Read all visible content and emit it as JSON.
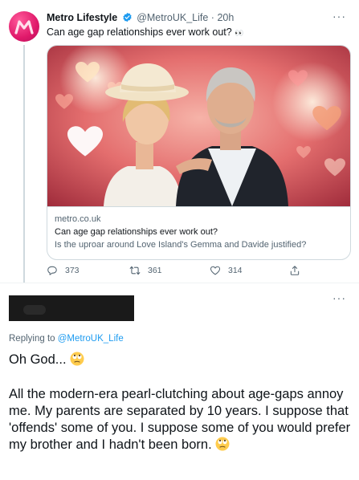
{
  "tweet": {
    "author_name": "Metro Lifestyle",
    "author_handle": "@MetroUK_Life",
    "separator": "·",
    "time": "20h",
    "text": "Can age gap relationships ever work out?",
    "eyes_emoji": "👀",
    "more": "···",
    "card": {
      "domain": "metro.co.uk",
      "title": "Can age gap relationships ever work out?",
      "description": "Is the uproar around Love Island's Gemma and Davide justified?"
    },
    "actions": {
      "reply_count": "373",
      "retweet_count": "361",
      "like_count": "314"
    }
  },
  "reply": {
    "more": "···",
    "replying_prefix": "Replying to ",
    "replying_mention": "@MetroUK_Life",
    "line1": "Oh God...",
    "body": "All the modern-era pearl-clutching about age-gaps annoy me.  My parents are separated by 10 years.  I suppose that 'offends' some of you.  I suppose some of you would prefer my brother and I hadn't been born."
  },
  "colors": {
    "brand_pink": "#e0196a",
    "link_blue": "#1d9bf0",
    "secondary_text": "#536471"
  }
}
